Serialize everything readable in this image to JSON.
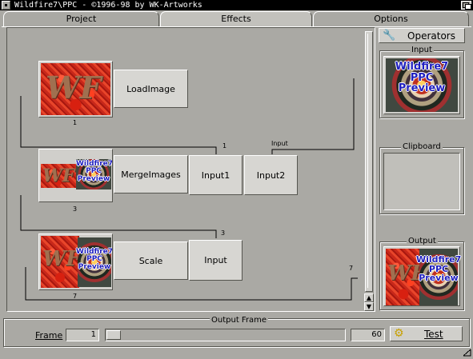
{
  "window": {
    "title": "Wildfire7\\PPC - ©1996-98 by WK-Artworks"
  },
  "tabs": [
    {
      "label": "Project",
      "active": false
    },
    {
      "label": "Effects",
      "active": true
    },
    {
      "label": "Options",
      "active": false
    }
  ],
  "nodes": {
    "load": {
      "thumb_text": "WF",
      "label": "LoadImage",
      "index": "1"
    },
    "merge": {
      "thumb_text": "WF",
      "preview_text": [
        "Wildfire7",
        "PPC",
        "Preview"
      ],
      "label": "MergeImages",
      "index": "3",
      "inputs": [
        {
          "label": "Input1",
          "source": "1"
        },
        {
          "label": "Input2",
          "source": "Input"
        }
      ]
    },
    "scale": {
      "thumb_text": "WF",
      "preview_text": [
        "Wildfire7",
        "PPC",
        "Preview"
      ],
      "label": "Scale",
      "index": "7",
      "inputs": [
        {
          "label": "Input",
          "source": "3"
        }
      ]
    },
    "output_index": "7"
  },
  "right_panel": {
    "operators_label": "Operators",
    "input_label": "Input",
    "input_preview": [
      "Wildfire7",
      "PPC",
      "Preview"
    ],
    "clipboard_label": "Clipboard",
    "output_label": "Output",
    "output_preview": [
      "Wildfire7",
      "PPC",
      "Preview"
    ]
  },
  "bottom": {
    "group_label": "Output Frame",
    "frame_label": "Frame",
    "frame_value": "1",
    "slider_position": 1,
    "max_frame": "60",
    "test_label": "Test"
  },
  "icons": [
    "close-icon",
    "depth-icon",
    "wrench-icon",
    "scroll-up-icon",
    "scroll-down-icon",
    "gear-icon"
  ]
}
